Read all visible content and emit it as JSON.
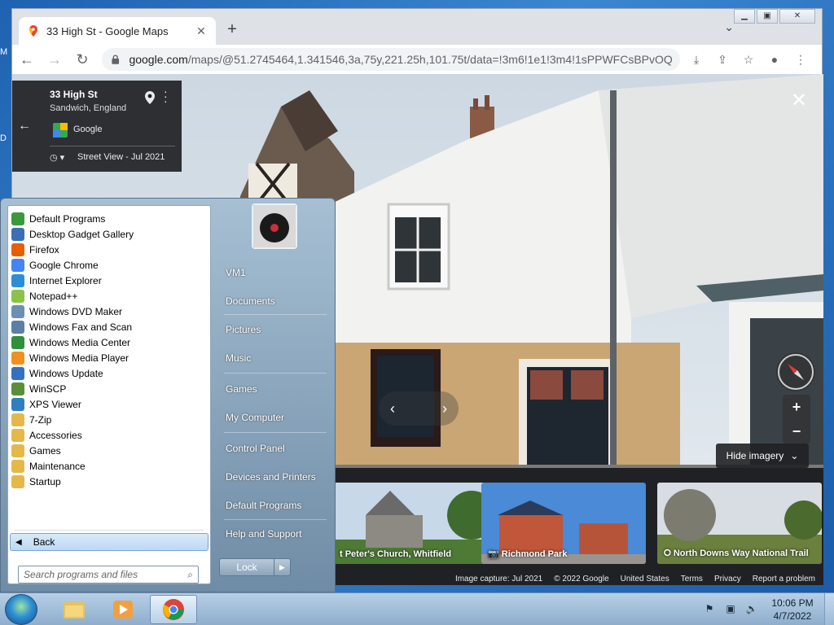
{
  "browser": {
    "tab_title": "33 High St - Google Maps",
    "tab_close": "✕",
    "new_tab": "+",
    "url_host": "google.com",
    "url_path": "/maps/@51.2745464,1.341546,3a,75y,221.25h,101.75t/data=!3m6!1e1!3m4!1sPPWFCsBPvOQcb...",
    "accent": "#1a73e8"
  },
  "streetview": {
    "address": "33 High St",
    "town": "Sandwich, England",
    "source": "Google",
    "capture_label": "Street View - Jul 2021",
    "hide_imagery": "Hide imagery",
    "zoom_in": "+",
    "zoom_out": "−",
    "close": "✕",
    "thumbnails": [
      {
        "label": "t Peter's Church, Whitfield",
        "icon": "none"
      },
      {
        "label": "Richmond Park",
        "icon": "camera-icon"
      },
      {
        "label": "North Downs Way National Trail",
        "icon": "360-icon"
      }
    ],
    "footer": [
      "Image capture: Jul 2021",
      "© 2022 Google",
      "United States",
      "Terms",
      "Privacy",
      "Report a problem"
    ]
  },
  "start_menu": {
    "programs": [
      {
        "label": "Default Programs",
        "color": "#3a9a3a"
      },
      {
        "label": "Desktop Gadget Gallery",
        "color": "#3b6fb5"
      },
      {
        "label": "Firefox",
        "color": "#e66000"
      },
      {
        "label": "Google Chrome",
        "color": "#4285f4"
      },
      {
        "label": "Internet Explorer",
        "color": "#2c8fd6"
      },
      {
        "label": "Notepad++",
        "color": "#8bc34a"
      },
      {
        "label": "Windows DVD Maker",
        "color": "#6d8fb2"
      },
      {
        "label": "Windows Fax and Scan",
        "color": "#5c7fa5"
      },
      {
        "label": "Windows Media Center",
        "color": "#2f8f3a"
      },
      {
        "label": "Windows Media Player",
        "color": "#f09020"
      },
      {
        "label": "Windows Update",
        "color": "#3571c0"
      },
      {
        "label": "WinSCP",
        "color": "#5a8f3a"
      },
      {
        "label": "XPS Viewer",
        "color": "#2f7fc0"
      },
      {
        "label": "7-Zip",
        "color": "#e5b84a"
      },
      {
        "label": "Accessories",
        "color": "#e5b84a"
      },
      {
        "label": "Games",
        "color": "#e5b84a"
      },
      {
        "label": "Maintenance",
        "color": "#e5b84a"
      },
      {
        "label": "Startup",
        "color": "#e5b84a"
      }
    ],
    "back_label": "Back",
    "search_placeholder": "Search programs and files",
    "right_links": [
      "VM1",
      "Documents",
      "Pictures",
      "Music",
      "Games",
      "My Computer",
      "Control Panel",
      "Devices and Printers",
      "Default Programs",
      "Help and Support"
    ],
    "lock_label": "Lock"
  },
  "taskbar": {
    "time": "10:06 PM",
    "date": "4/7/2022"
  },
  "desktop": {
    "edge_letters": [
      "M",
      "D"
    ]
  }
}
